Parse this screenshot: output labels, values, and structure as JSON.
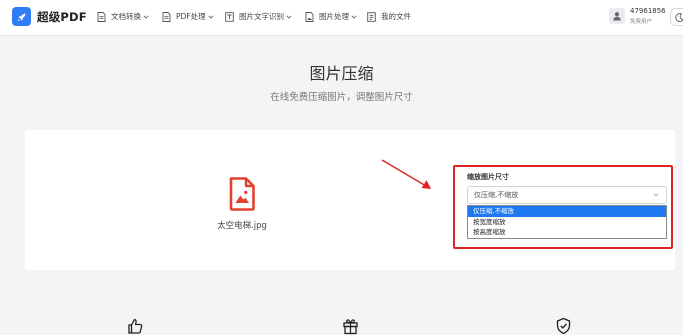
{
  "brand": {
    "name": "超级PDF",
    "accent": "#2f7cf6"
  },
  "nav": {
    "items": [
      {
        "label": "文档转换",
        "icon": "document-icon"
      },
      {
        "label": "PDF处理",
        "icon": "document-icon"
      },
      {
        "label": "图片文字识别",
        "icon": "image-text-icon"
      },
      {
        "label": "图片处理",
        "icon": "image-file-icon"
      },
      {
        "label": "我的文件",
        "icon": "folder-icon"
      }
    ]
  },
  "user": {
    "id": "47961856",
    "status": "免费用户",
    "theme_icon": "moon-icon"
  },
  "page": {
    "title": "图片压缩",
    "subtitle": "在线免费压缩图片，调整图片尺寸"
  },
  "file": {
    "name": "太空电梯.jpg",
    "icon": "image-file-icon"
  },
  "resize": {
    "label": "缩放图片尺寸",
    "selected": "仅压缩,不缩放",
    "options": [
      "仅压缩,不缩放",
      "按宽度缩放",
      "按高度缩放"
    ],
    "highlight_color": "#e02424"
  },
  "features": {
    "icons": [
      "thumbs-up-icon",
      "gift-icon",
      "shield-check-icon"
    ]
  }
}
